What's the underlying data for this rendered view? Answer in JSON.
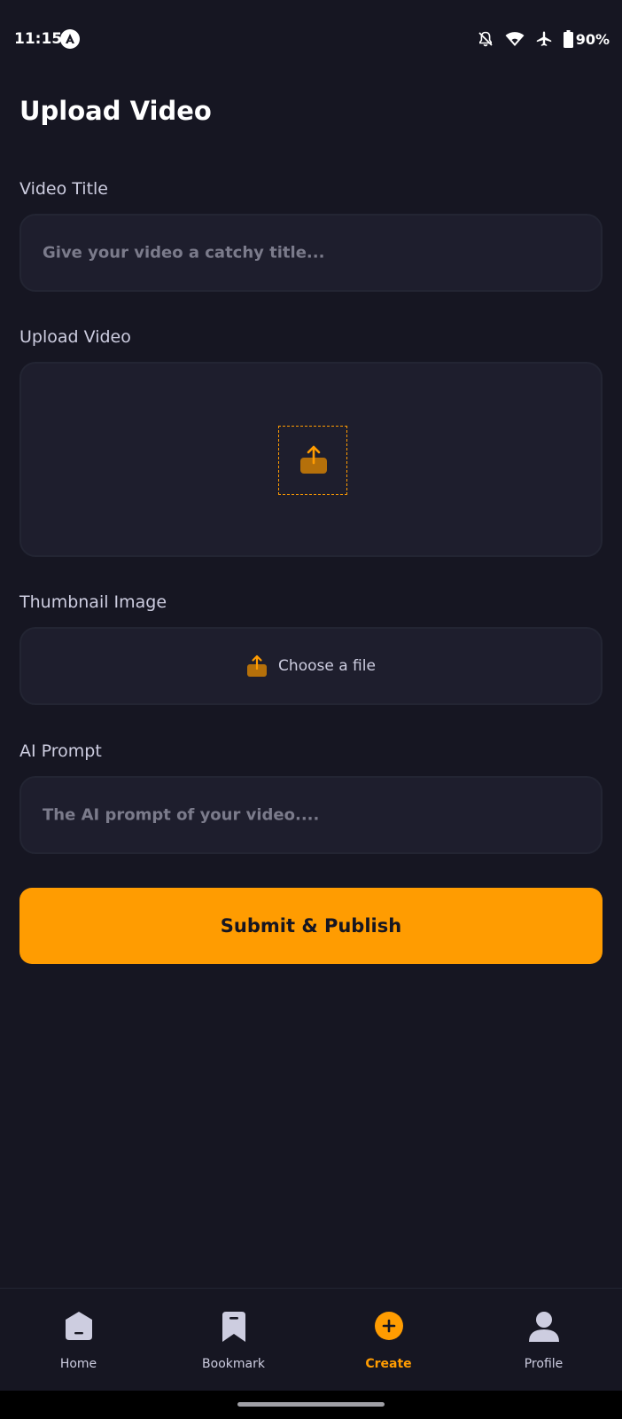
{
  "status_bar": {
    "time": "11:15",
    "battery": "90%",
    "icons": [
      "app-notification-icon",
      "bell-off-icon",
      "wifi-icon",
      "airplane-icon",
      "battery-icon"
    ]
  },
  "page": {
    "title": "Upload Video"
  },
  "form": {
    "video_title": {
      "label": "Video Title",
      "placeholder": "Give your video a catchy title..."
    },
    "upload_video": {
      "label": "Upload Video",
      "icon": "upload-icon"
    },
    "thumbnail": {
      "label": "Thumbnail Image",
      "button_text": "Choose a file",
      "icon": "upload-icon"
    },
    "ai_prompt": {
      "label": "AI Prompt",
      "placeholder": "The AI prompt of your video...."
    },
    "submit_label": "Submit & Publish"
  },
  "tabs": [
    {
      "label": "Home",
      "icon": "home-icon",
      "active": false
    },
    {
      "label": "Bookmark",
      "icon": "bookmark-icon",
      "active": false
    },
    {
      "label": "Create",
      "icon": "plus-icon",
      "active": true
    },
    {
      "label": "Profile",
      "icon": "profile-icon",
      "active": false
    }
  ],
  "colors": {
    "background": "#161622",
    "input_bg": "#1E1E2D",
    "input_border": "#232533",
    "accent": "#FF9C01",
    "label": "#CDCDE0",
    "placeholder": "#7B7B8B"
  }
}
